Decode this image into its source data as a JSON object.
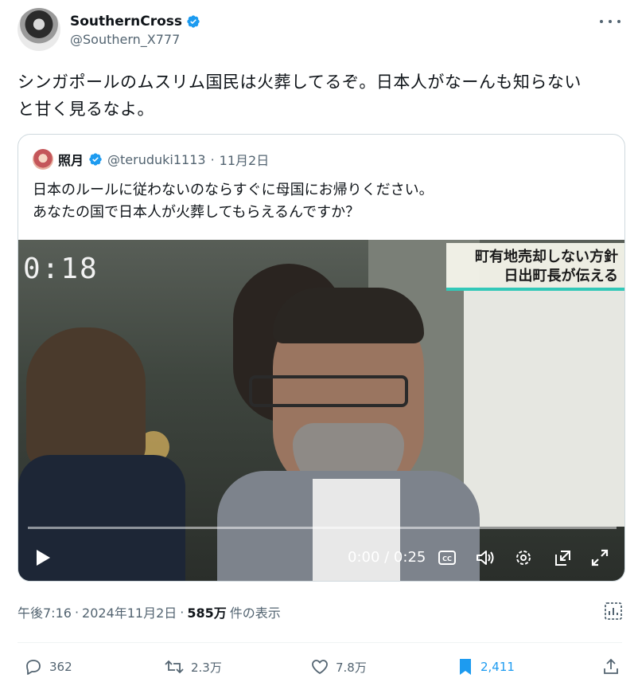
{
  "tweet": {
    "display_name": "SouthernCross",
    "handle": "@Southern_X777",
    "text_line1": "シンガポールのムスリム国民は火葬してるぞ。日本人がなーんも知らない",
    "text_line2": "と甘く見るなよ。"
  },
  "quote": {
    "display_name": "照月",
    "handle": "@teruduki1113",
    "separator": "·",
    "date": "11月2日",
    "text_line1": "日本のルールに従わないのならすぐに母国にお帰りください。",
    "text_line2": "あなたの国で日本人が火葬してもらえるんですか？",
    "video": {
      "timer_overlay": "0:18",
      "caption_line1": "町有地売却しない方針",
      "caption_line2": "日出町長が伝える",
      "time_display": "0:00 / 0:25",
      "progress": 0.0
    }
  },
  "meta": {
    "time": "午後7:16",
    "separator1": "·",
    "date": "2024年11月2日",
    "separator2": "·",
    "views": "585万",
    "views_label": "件の表示"
  },
  "actions": {
    "replies": "362",
    "retweets": "2.3万",
    "likes": "7.8万",
    "bookmarks": "2,411"
  },
  "colors": {
    "verified": "#1d9bf0",
    "accent": "#1d9bf0",
    "secondary_text": "#536471",
    "caption_bar": "#33c8b8"
  },
  "icons": [
    "verified-badge-icon",
    "more-icon",
    "play-icon",
    "closed-captions-icon",
    "volume-icon",
    "settings-icon",
    "pip-icon",
    "fullscreen-icon",
    "analytics-icon",
    "reply-icon",
    "retweet-icon",
    "like-icon",
    "bookmark-icon",
    "share-icon"
  ]
}
